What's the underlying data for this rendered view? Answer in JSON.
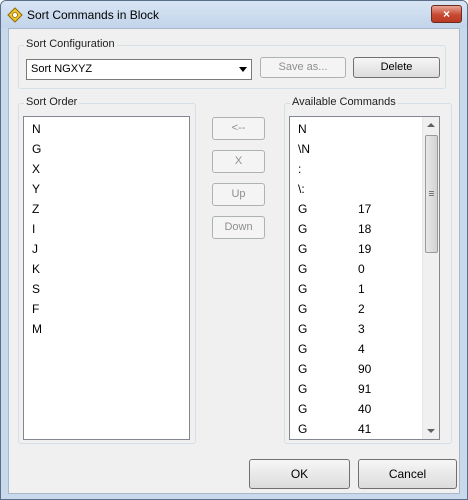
{
  "window": {
    "title": "Sort Commands in Block",
    "close_label": "×"
  },
  "config": {
    "group_label": "Sort Configuration",
    "selected": "Sort NGXYZ",
    "save_as_label": "Save as...",
    "delete_label": "Delete"
  },
  "sort_order": {
    "label": "Sort Order",
    "items": [
      "N",
      "G",
      "X",
      "Y",
      "Z",
      "I",
      "J",
      "K",
      "S",
      "F",
      "M"
    ]
  },
  "middle_buttons": {
    "add": "<--",
    "remove": "X",
    "up": "Up",
    "down": "Down"
  },
  "available": {
    "label": "Available Commands",
    "items": [
      {
        "cmd": "N",
        "val": ""
      },
      {
        "cmd": "\\N",
        "val": ""
      },
      {
        "cmd": ":",
        "val": ""
      },
      {
        "cmd": "\\:",
        "val": ""
      },
      {
        "cmd": "G",
        "val": "17"
      },
      {
        "cmd": "G",
        "val": "18"
      },
      {
        "cmd": "G",
        "val": "19"
      },
      {
        "cmd": "G",
        "val": "0"
      },
      {
        "cmd": "G",
        "val": "1"
      },
      {
        "cmd": "G",
        "val": "2"
      },
      {
        "cmd": "G",
        "val": "3"
      },
      {
        "cmd": "G",
        "val": "4"
      },
      {
        "cmd": "G",
        "val": "90"
      },
      {
        "cmd": "G",
        "val": "91"
      },
      {
        "cmd": "G",
        "val": "40"
      },
      {
        "cmd": "G",
        "val": "41"
      }
    ]
  },
  "footer": {
    "ok_label": "OK",
    "cancel_label": "Cancel"
  }
}
